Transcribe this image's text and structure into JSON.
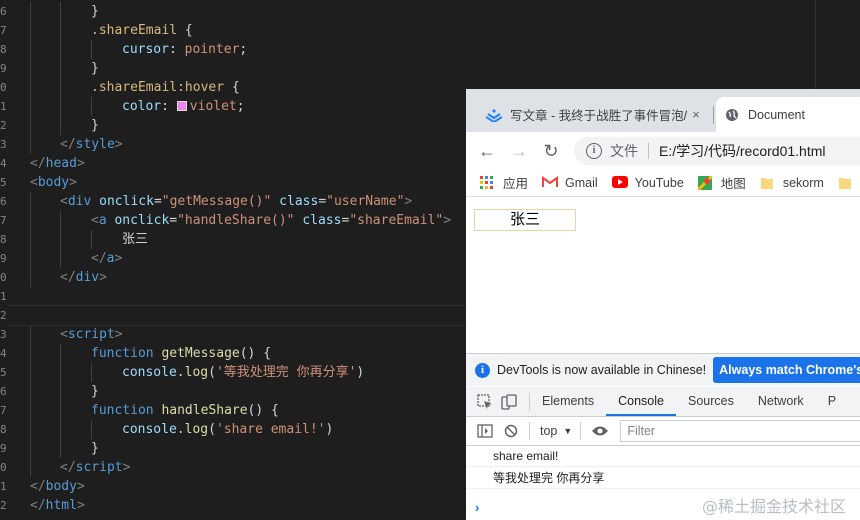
{
  "editor": {
    "line_numbers": [
      "6",
      "7",
      "8",
      "9",
      "0",
      "1",
      "2",
      "3",
      "4",
      "5",
      "6",
      "7",
      "8",
      "9",
      "0",
      "1",
      "2",
      "3",
      "4",
      "5",
      "6",
      "7",
      "8",
      "9",
      "0",
      "1",
      "2"
    ],
    "lines": [
      [
        {
          "c": "punc",
          "t": "}"
        }
      ],
      [
        {
          "c": "sel",
          "t": ".shareEmail"
        },
        {
          "c": "punc",
          "t": " {"
        }
      ],
      [
        {
          "c": "prop",
          "t": "cursor"
        },
        {
          "c": "punc",
          "t": ": "
        },
        {
          "c": "str",
          "t": "pointer"
        },
        {
          "c": "punc",
          "t": ";"
        }
      ],
      [
        {
          "c": "punc",
          "t": "}"
        }
      ],
      [
        {
          "c": "sel",
          "t": ".shareEmail:hover"
        },
        {
          "c": "punc",
          "t": " {"
        }
      ],
      [
        {
          "c": "prop",
          "t": "color"
        },
        {
          "c": "punc",
          "t": ": "
        },
        {
          "c": "swatch",
          "t": ""
        },
        {
          "c": "str",
          "t": "violet"
        },
        {
          "c": "punc",
          "t": ";"
        }
      ],
      [
        {
          "c": "punc",
          "t": "}"
        }
      ],
      [
        {
          "c": "bracket",
          "t": "</"
        },
        {
          "c": "tag",
          "t": "style"
        },
        {
          "c": "bracket",
          "t": ">"
        }
      ],
      [
        {
          "c": "bracket",
          "t": "</"
        },
        {
          "c": "tag",
          "t": "head"
        },
        {
          "c": "bracket",
          "t": ">"
        }
      ],
      [
        {
          "c": "bracket",
          "t": "<"
        },
        {
          "c": "tag",
          "t": "body"
        },
        {
          "c": "bracket",
          "t": ">"
        }
      ],
      [
        {
          "c": "bracket",
          "t": "<"
        },
        {
          "c": "tag",
          "t": "div"
        },
        {
          "c": "punc",
          "t": " "
        },
        {
          "c": "attr",
          "t": "onclick"
        },
        {
          "c": "punc",
          "t": "="
        },
        {
          "c": "str",
          "t": "\"getMessage()\""
        },
        {
          "c": "punc",
          "t": " "
        },
        {
          "c": "attr",
          "t": "class"
        },
        {
          "c": "punc",
          "t": "="
        },
        {
          "c": "str",
          "t": "\"userName\""
        },
        {
          "c": "bracket",
          "t": ">"
        }
      ],
      [
        {
          "c": "bracket",
          "t": "<"
        },
        {
          "c": "tag",
          "t": "a"
        },
        {
          "c": "punc",
          "t": " "
        },
        {
          "c": "attr",
          "t": "onclick"
        },
        {
          "c": "punc",
          "t": "="
        },
        {
          "c": "str",
          "t": "\"handleShare()\""
        },
        {
          "c": "punc",
          "t": " "
        },
        {
          "c": "attr",
          "t": "class"
        },
        {
          "c": "punc",
          "t": "="
        },
        {
          "c": "str",
          "t": "\"shareEmail\""
        },
        {
          "c": "bracket",
          "t": ">"
        }
      ],
      [
        {
          "c": "text",
          "t": "张三"
        }
      ],
      [
        {
          "c": "bracket",
          "t": "</"
        },
        {
          "c": "tag",
          "t": "a"
        },
        {
          "c": "bracket",
          "t": ">"
        }
      ],
      [
        {
          "c": "bracket",
          "t": "</"
        },
        {
          "c": "tag",
          "t": "div"
        },
        {
          "c": "bracket",
          "t": ">"
        }
      ],
      [],
      [],
      [
        {
          "c": "bracket",
          "t": "<"
        },
        {
          "c": "tag",
          "t": "script"
        },
        {
          "c": "bracket",
          "t": ">"
        }
      ],
      [
        {
          "c": "kw",
          "t": "function"
        },
        {
          "c": "punc",
          "t": " "
        },
        {
          "c": "fn",
          "t": "getMessage"
        },
        {
          "c": "punc",
          "t": "() {"
        }
      ],
      [
        {
          "c": "prop",
          "t": "console"
        },
        {
          "c": "punc",
          "t": "."
        },
        {
          "c": "fn",
          "t": "log"
        },
        {
          "c": "punc",
          "t": "("
        },
        {
          "c": "str",
          "t": "'等我处理完 你再分享'"
        },
        {
          "c": "punc",
          "t": ")"
        }
      ],
      [
        {
          "c": "punc",
          "t": "}"
        }
      ],
      [
        {
          "c": "kw",
          "t": "function"
        },
        {
          "c": "punc",
          "t": " "
        },
        {
          "c": "fn",
          "t": "handleShare"
        },
        {
          "c": "punc",
          "t": "() {"
        }
      ],
      [
        {
          "c": "prop",
          "t": "console"
        },
        {
          "c": "punc",
          "t": "."
        },
        {
          "c": "fn",
          "t": "log"
        },
        {
          "c": "punc",
          "t": "("
        },
        {
          "c": "str",
          "t": "'share email!'"
        },
        {
          "c": "punc",
          "t": ")"
        }
      ],
      [
        {
          "c": "punc",
          "t": "}"
        }
      ],
      [
        {
          "c": "bracket",
          "t": "</"
        },
        {
          "c": "tag",
          "t": "script"
        },
        {
          "c": "bracket",
          "t": ">"
        }
      ],
      [
        {
          "c": "bracket",
          "t": "</"
        },
        {
          "c": "tag",
          "t": "body"
        },
        {
          "c": "bracket",
          "t": ">"
        }
      ],
      [
        {
          "c": "bracket",
          "t": "</"
        },
        {
          "c": "tag",
          "t": "html"
        },
        {
          "c": "bracket",
          "t": ">"
        }
      ]
    ],
    "swatch_color": "#ee82ee"
  },
  "browser": {
    "tabs": [
      {
        "title": "写文章 - 我终于战胜了事件冒泡/",
        "icon": "juejin-logo-icon",
        "close": "×",
        "active": false
      },
      {
        "title": "Document",
        "icon": "globe-icon",
        "active": true
      }
    ],
    "nav": {
      "back": "←",
      "forward": "→",
      "reload": "↻"
    },
    "omnibox": {
      "label": "文件",
      "url": "E:/学习/代码/record01.html"
    },
    "bookmarks": [
      {
        "label": "应用",
        "icon": "apps-grid-icon"
      },
      {
        "label": "Gmail",
        "icon": "gmail-icon"
      },
      {
        "label": "YouTube",
        "icon": "youtube-icon"
      },
      {
        "label": "地图",
        "icon": "maps-icon"
      },
      {
        "label": "sekorm",
        "icon": "folder-icon"
      }
    ],
    "page": {
      "user_name": "张三"
    },
    "devtools": {
      "banner_text": "DevTools is now available in Chinese!",
      "banner_button": "Always match Chrome's",
      "tabs": [
        "Elements",
        "Console",
        "Sources",
        "Network",
        "P"
      ],
      "active_tab": "Console",
      "context": "top",
      "filter_placeholder": "Filter",
      "messages": [
        "share email!",
        "等我处理完 你再分享"
      ],
      "prompt": "›"
    }
  },
  "watermark": "@稀土掘金技术社区"
}
